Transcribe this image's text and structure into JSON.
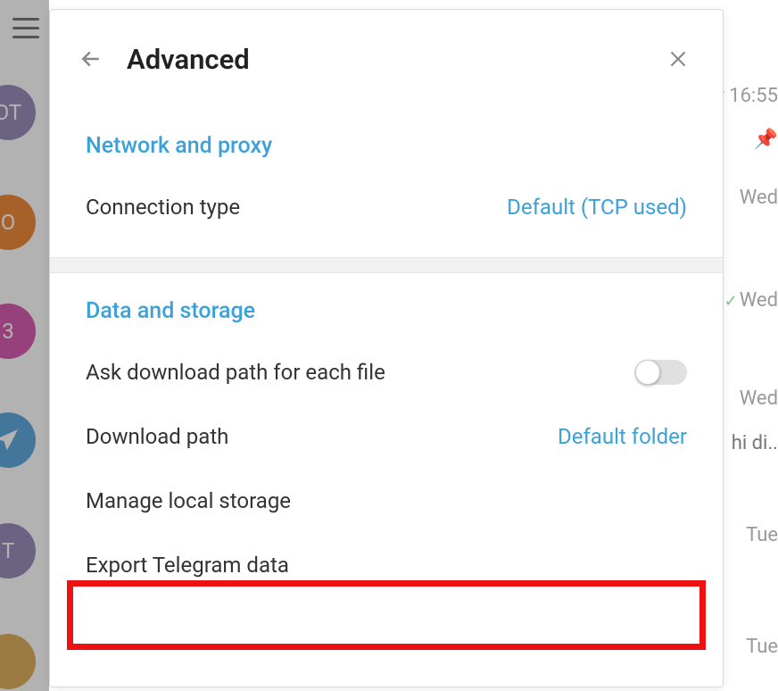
{
  "panel": {
    "title": "Advanced"
  },
  "network": {
    "section_title": "Network and proxy",
    "connection_type_label": "Connection type",
    "connection_type_value": "Default (TCP used)"
  },
  "data_storage": {
    "section_title": "Data and storage",
    "ask_path_label": "Ask download path for each file",
    "ask_path_value": "off",
    "download_path_label": "Download path",
    "download_path_value": "Default folder",
    "manage_storage_label": "Manage local storage",
    "export_label": "Export Telegram data"
  },
  "background": {
    "avatars": [
      {
        "label": "OT",
        "color": "#9b8fbc"
      },
      {
        "label": "O",
        "color": "#f08c3a"
      },
      {
        "label": "3",
        "color": "#d85db2"
      },
      {
        "label": "",
        "color": "#5fa9dd"
      },
      {
        "label": "T",
        "color": "#9b8fbc"
      },
      {
        "label": "",
        "color": "#e0b060"
      }
    ],
    "right_items": [
      {
        "text": "16:55",
        "checks": true
      },
      {
        "text": "",
        "pin": true
      },
      {
        "text": "Wed"
      },
      {
        "text": "Wed",
        "checks": true
      },
      {
        "text": "Wed"
      },
      {
        "text": "hi di.."
      },
      {
        "text": "Tue"
      },
      {
        "text": "Tue"
      }
    ]
  }
}
